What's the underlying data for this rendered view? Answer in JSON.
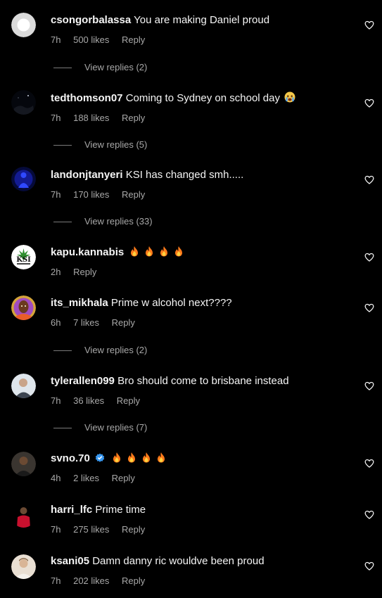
{
  "comments": [
    {
      "username": "csongorbalassa",
      "text": "You are making Daniel proud",
      "time": "7h",
      "likes": "500 likes",
      "reply": "Reply",
      "view_replies": "View replies (2)",
      "avatar": "default-avatar"
    },
    {
      "username": "tedthomson07",
      "text": "Coming to Sydney on school day",
      "emoji": "crying-face-emoji",
      "time": "7h",
      "likes": "188 likes",
      "reply": "Reply",
      "view_replies": "View replies (5)",
      "avatar": "night-sky-avatar"
    },
    {
      "username": "landonjtanyeri",
      "text": "KSI has changed smh.....",
      "time": "7h",
      "likes": "170 likes",
      "reply": "Reply",
      "view_replies": "View replies (33)",
      "avatar": "blue-figure-avatar"
    },
    {
      "username": "kapu.kannabis",
      "text": "",
      "fire_count": 4,
      "time": "2h",
      "likes": "",
      "reply": "Reply",
      "avatar": "ksi-logo-avatar",
      "avatar_logo_text": "KSI"
    },
    {
      "username": "its_mikhala",
      "text": "Prime w alcohol next????",
      "time": "6h",
      "likes": "7 likes",
      "reply": "Reply",
      "view_replies": "View replies (2)",
      "avatar": "portrait-avatar"
    },
    {
      "username": "tylerallen099",
      "text": "Bro should come to brisbane instead",
      "time": "7h",
      "likes": "36 likes",
      "reply": "Reply",
      "view_replies": "View replies (7)",
      "avatar": "person-avatar"
    },
    {
      "username": "svno.70",
      "verified": true,
      "text": "",
      "fire_count": 4,
      "time": "4h",
      "likes": "2 likes",
      "reply": "Reply",
      "avatar": "dark-person-avatar"
    },
    {
      "username": "harri_lfc",
      "text": "Prime time",
      "time": "7h",
      "likes": "275 likes",
      "reply": "Reply",
      "avatar": "red-jersey-avatar"
    },
    {
      "username": "ksani05",
      "text": "Damn danny ric wouldve been proud",
      "time": "7h",
      "likes": "202 likes",
      "reply": "Reply",
      "avatar": "light-person-avatar"
    }
  ],
  "colors": {
    "background": "#000000",
    "primary_text": "#f5f5f5",
    "secondary_text": "#a8a8a8",
    "fire": "#ff7a1a",
    "verified": "#3797f0"
  }
}
